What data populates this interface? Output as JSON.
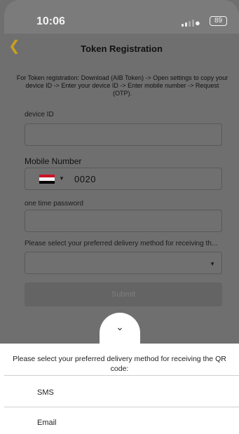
{
  "status_bar": {
    "time": "10:06",
    "battery": "89"
  },
  "header": {
    "title": "Token Registration",
    "back_icon": "chevron-left-icon"
  },
  "instructions": "For Token registration: Download (AIB Token) -> Open settings to copy your device ID -> Enter your device ID -> Enter mobile number -> Request (OTP).",
  "form": {
    "device_id_label": "device ID",
    "device_id_value": "",
    "mobile_label": "Mobile Number",
    "country_code": "0020",
    "country_flag": "egypt-flag-icon",
    "otp_label": "one time password",
    "otp_value": "",
    "delivery_label": "Please select your preferred delivery method for receiving th...",
    "delivery_value": "",
    "submit_label": "Submit"
  },
  "sheet": {
    "title": "Please select your preferred delivery method for receiving the QR code:",
    "options": [
      "SMS",
      "Email"
    ]
  },
  "colors": {
    "accent": "#c8a020",
    "overlay": "#6f6f6f",
    "sheet_bg": "#ffffff"
  }
}
